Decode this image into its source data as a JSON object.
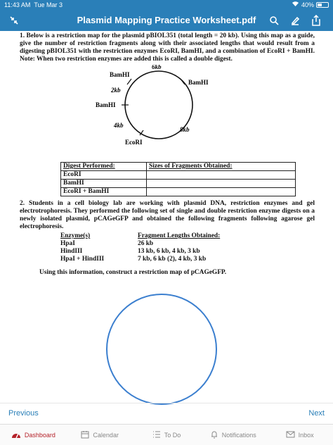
{
  "status": {
    "time": "11:43 AM",
    "date": "Tue Mar 3",
    "battery": "40%"
  },
  "header": {
    "title": "Plasmid Mapping Practice Worksheet.pdf"
  },
  "q1": {
    "text": "1.  Below is a restriction map for the plasmid pBIOL351 (total length = 20 kb).  Using this map as a guide, give the number of restriction fragments along with their associated lengths that would result from a digesting pBIOL351 with the restriction enzymes EcoRI, BamHI, and a combination of EcoRI + BamHI. Note: When two restriction enzymes are added this is called a double digest.",
    "map": {
      "labels": [
        "6kb",
        "BamHI",
        "BamHI",
        "2kb",
        "BamHI",
        "4kb",
        "8kb",
        "EcoRI"
      ]
    },
    "table": {
      "header": [
        "Digest Performed:",
        "Sizes of Fragments Obtained:"
      ],
      "rows": [
        [
          "EcoRI",
          ""
        ],
        [
          "BamHI",
          ""
        ],
        [
          "EcoRI + BamHI",
          ""
        ]
      ]
    }
  },
  "q2": {
    "text": "2.  Students in a cell biology lab are working with plasmid DNA, restriction enzymes and gel electrotrophoresis. They performed the following set of single and double restriction enzyme digests on a newly isolated plasmid, pCAGeGFP and obtained the following fragments following agarose gel electrophoresis.",
    "header": [
      "Enzyme(s)",
      "Fragment Lengths Obtained:"
    ],
    "rows": [
      [
        "HpaI",
        "26 kb"
      ],
      [
        "HindIII",
        "13 kb,  6 kb,  4 kb,  3 kb"
      ],
      [
        "HpaI + HindIII",
        "7 kb,  6 kb (2),  4 kb,  3 kb"
      ]
    ],
    "prompt": "Using this information, construct a restriction map of pCAGeGFP."
  },
  "pager": {
    "previous": "Previous",
    "next": "Next"
  },
  "tabs": [
    {
      "label": "Dashboard",
      "icon": "dashboard-icon"
    },
    {
      "label": "Calendar",
      "icon": "calendar-icon"
    },
    {
      "label": "To Do",
      "icon": "todo-icon"
    },
    {
      "label": "Notifications",
      "icon": "bell-icon"
    },
    {
      "label": "Inbox",
      "icon": "inbox-icon"
    }
  ],
  "colors": {
    "header": "#2a7fb8",
    "active_tab": "#b5222a",
    "circle_blue": "#3b7fcf"
  }
}
